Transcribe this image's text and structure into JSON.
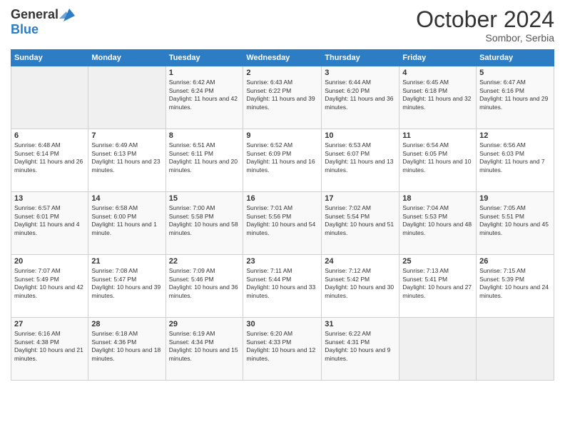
{
  "header": {
    "logo_general": "General",
    "logo_blue": "Blue",
    "month_title": "October 2024",
    "subtitle": "Sombor, Serbia"
  },
  "calendar": {
    "days_of_week": [
      "Sunday",
      "Monday",
      "Tuesday",
      "Wednesday",
      "Thursday",
      "Friday",
      "Saturday"
    ],
    "weeks": [
      [
        {
          "day": "",
          "sunrise": "",
          "sunset": "",
          "daylight": ""
        },
        {
          "day": "",
          "sunrise": "",
          "sunset": "",
          "daylight": ""
        },
        {
          "day": "1",
          "sunrise": "Sunrise: 6:42 AM",
          "sunset": "Sunset: 6:24 PM",
          "daylight": "Daylight: 11 hours and 42 minutes."
        },
        {
          "day": "2",
          "sunrise": "Sunrise: 6:43 AM",
          "sunset": "Sunset: 6:22 PM",
          "daylight": "Daylight: 11 hours and 39 minutes."
        },
        {
          "day": "3",
          "sunrise": "Sunrise: 6:44 AM",
          "sunset": "Sunset: 6:20 PM",
          "daylight": "Daylight: 11 hours and 36 minutes."
        },
        {
          "day": "4",
          "sunrise": "Sunrise: 6:45 AM",
          "sunset": "Sunset: 6:18 PM",
          "daylight": "Daylight: 11 hours and 32 minutes."
        },
        {
          "day": "5",
          "sunrise": "Sunrise: 6:47 AM",
          "sunset": "Sunset: 6:16 PM",
          "daylight": "Daylight: 11 hours and 29 minutes."
        }
      ],
      [
        {
          "day": "6",
          "sunrise": "Sunrise: 6:48 AM",
          "sunset": "Sunset: 6:14 PM",
          "daylight": "Daylight: 11 hours and 26 minutes."
        },
        {
          "day": "7",
          "sunrise": "Sunrise: 6:49 AM",
          "sunset": "Sunset: 6:13 PM",
          "daylight": "Daylight: 11 hours and 23 minutes."
        },
        {
          "day": "8",
          "sunrise": "Sunrise: 6:51 AM",
          "sunset": "Sunset: 6:11 PM",
          "daylight": "Daylight: 11 hours and 20 minutes."
        },
        {
          "day": "9",
          "sunrise": "Sunrise: 6:52 AM",
          "sunset": "Sunset: 6:09 PM",
          "daylight": "Daylight: 11 hours and 16 minutes."
        },
        {
          "day": "10",
          "sunrise": "Sunrise: 6:53 AM",
          "sunset": "Sunset: 6:07 PM",
          "daylight": "Daylight: 11 hours and 13 minutes."
        },
        {
          "day": "11",
          "sunrise": "Sunrise: 6:54 AM",
          "sunset": "Sunset: 6:05 PM",
          "daylight": "Daylight: 11 hours and 10 minutes."
        },
        {
          "day": "12",
          "sunrise": "Sunrise: 6:56 AM",
          "sunset": "Sunset: 6:03 PM",
          "daylight": "Daylight: 11 hours and 7 minutes."
        }
      ],
      [
        {
          "day": "13",
          "sunrise": "Sunrise: 6:57 AM",
          "sunset": "Sunset: 6:01 PM",
          "daylight": "Daylight: 11 hours and 4 minutes."
        },
        {
          "day": "14",
          "sunrise": "Sunrise: 6:58 AM",
          "sunset": "Sunset: 6:00 PM",
          "daylight": "Daylight: 11 hours and 1 minute."
        },
        {
          "day": "15",
          "sunrise": "Sunrise: 7:00 AM",
          "sunset": "Sunset: 5:58 PM",
          "daylight": "Daylight: 10 hours and 58 minutes."
        },
        {
          "day": "16",
          "sunrise": "Sunrise: 7:01 AM",
          "sunset": "Sunset: 5:56 PM",
          "daylight": "Daylight: 10 hours and 54 minutes."
        },
        {
          "day": "17",
          "sunrise": "Sunrise: 7:02 AM",
          "sunset": "Sunset: 5:54 PM",
          "daylight": "Daylight: 10 hours and 51 minutes."
        },
        {
          "day": "18",
          "sunrise": "Sunrise: 7:04 AM",
          "sunset": "Sunset: 5:53 PM",
          "daylight": "Daylight: 10 hours and 48 minutes."
        },
        {
          "day": "19",
          "sunrise": "Sunrise: 7:05 AM",
          "sunset": "Sunset: 5:51 PM",
          "daylight": "Daylight: 10 hours and 45 minutes."
        }
      ],
      [
        {
          "day": "20",
          "sunrise": "Sunrise: 7:07 AM",
          "sunset": "Sunset: 5:49 PM",
          "daylight": "Daylight: 10 hours and 42 minutes."
        },
        {
          "day": "21",
          "sunrise": "Sunrise: 7:08 AM",
          "sunset": "Sunset: 5:47 PM",
          "daylight": "Daylight: 10 hours and 39 minutes."
        },
        {
          "day": "22",
          "sunrise": "Sunrise: 7:09 AM",
          "sunset": "Sunset: 5:46 PM",
          "daylight": "Daylight: 10 hours and 36 minutes."
        },
        {
          "day": "23",
          "sunrise": "Sunrise: 7:11 AM",
          "sunset": "Sunset: 5:44 PM",
          "daylight": "Daylight: 10 hours and 33 minutes."
        },
        {
          "day": "24",
          "sunrise": "Sunrise: 7:12 AM",
          "sunset": "Sunset: 5:42 PM",
          "daylight": "Daylight: 10 hours and 30 minutes."
        },
        {
          "day": "25",
          "sunrise": "Sunrise: 7:13 AM",
          "sunset": "Sunset: 5:41 PM",
          "daylight": "Daylight: 10 hours and 27 minutes."
        },
        {
          "day": "26",
          "sunrise": "Sunrise: 7:15 AM",
          "sunset": "Sunset: 5:39 PM",
          "daylight": "Daylight: 10 hours and 24 minutes."
        }
      ],
      [
        {
          "day": "27",
          "sunrise": "Sunrise: 6:16 AM",
          "sunset": "Sunset: 4:38 PM",
          "daylight": "Daylight: 10 hours and 21 minutes."
        },
        {
          "day": "28",
          "sunrise": "Sunrise: 6:18 AM",
          "sunset": "Sunset: 4:36 PM",
          "daylight": "Daylight: 10 hours and 18 minutes."
        },
        {
          "day": "29",
          "sunrise": "Sunrise: 6:19 AM",
          "sunset": "Sunset: 4:34 PM",
          "daylight": "Daylight: 10 hours and 15 minutes."
        },
        {
          "day": "30",
          "sunrise": "Sunrise: 6:20 AM",
          "sunset": "Sunset: 4:33 PM",
          "daylight": "Daylight: 10 hours and 12 minutes."
        },
        {
          "day": "31",
          "sunrise": "Sunrise: 6:22 AM",
          "sunset": "Sunset: 4:31 PM",
          "daylight": "Daylight: 10 hours and 9 minutes."
        },
        {
          "day": "",
          "sunrise": "",
          "sunset": "",
          "daylight": ""
        },
        {
          "day": "",
          "sunrise": "",
          "sunset": "",
          "daylight": ""
        }
      ]
    ]
  }
}
